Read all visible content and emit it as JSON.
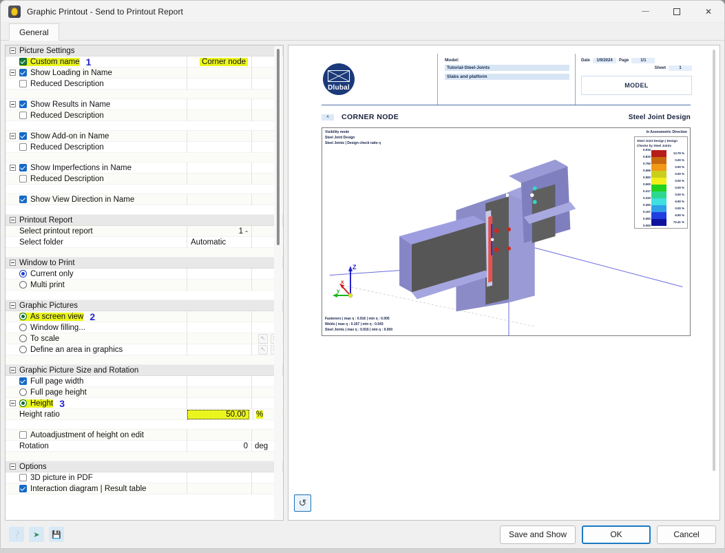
{
  "window": {
    "title": "Graphic Printout - Send to Printout Report",
    "app_icon": "dlubal-lock-icon",
    "minimize": "minimize-icon",
    "maximize": "maximize-icon",
    "close": "close-icon"
  },
  "tabs": [
    {
      "label": "General"
    }
  ],
  "tree": {
    "groups": [
      {
        "title": "Picture Settings",
        "rows": [
          {
            "label": "Custom name",
            "control": "checkbox-green-checked",
            "value": "Corner node",
            "unit": "",
            "highlight": true,
            "marker": "1"
          },
          {
            "label": "Show Loading in Name",
            "control": "checkbox-checked",
            "value": "",
            "unit": "",
            "expander": true
          },
          {
            "label": "Reduced Description",
            "control": "checkbox",
            "value": "",
            "unit": "",
            "indent": 2
          },
          {
            "spacer": true
          },
          {
            "label": "Show Results in Name",
            "control": "checkbox-checked",
            "value": "",
            "unit": "",
            "expander": true
          },
          {
            "label": "Reduced Description",
            "control": "checkbox",
            "value": "",
            "unit": "",
            "indent": 2
          },
          {
            "spacer": true
          },
          {
            "label": "Show Add-on in Name",
            "control": "checkbox-checked",
            "value": "",
            "unit": "",
            "expander": true
          },
          {
            "label": "Reduced Description",
            "control": "checkbox",
            "value": "",
            "unit": "",
            "indent": 2
          },
          {
            "spacer": true
          },
          {
            "label": "Show Imperfections in Name",
            "control": "checkbox-checked",
            "value": "",
            "unit": "",
            "expander": true
          },
          {
            "label": "Reduced Description",
            "control": "checkbox",
            "value": "",
            "unit": "",
            "indent": 2
          },
          {
            "spacer": true
          },
          {
            "label": "Show View Direction in Name",
            "control": "checkbox-checked",
            "value": "",
            "unit": ""
          },
          {
            "spacer": true
          }
        ]
      },
      {
        "title": "Printout Report",
        "rows": [
          {
            "label": "Select printout report",
            "control": "none",
            "value": "1 -",
            "unit": ""
          },
          {
            "label": "Select folder",
            "control": "none",
            "value": "Automatic",
            "unit": "",
            "value_align": "left"
          },
          {
            "spacer": true
          }
        ]
      },
      {
        "title": "Window to Print",
        "rows": [
          {
            "label": "Current only",
            "control": "radio-checked",
            "value": "",
            "unit": ""
          },
          {
            "label": "Multi print",
            "control": "radio",
            "value": "",
            "unit": ""
          },
          {
            "spacer": true
          }
        ]
      },
      {
        "title": "Graphic Pictures",
        "rows": [
          {
            "label": "As screen view",
            "control": "radio-green-checked",
            "value": "",
            "unit": "",
            "highlight": true,
            "marker": "2"
          },
          {
            "label": "Window filling...",
            "control": "radio",
            "value": "",
            "unit": ""
          },
          {
            "label": "To scale",
            "control": "radio",
            "value": "",
            "unit": "",
            "icons": [
              "pick-icon",
              "clear-icon"
            ]
          },
          {
            "label": "Define an area in graphics",
            "control": "radio",
            "value": "",
            "unit": "",
            "icons": [
              "pick-icon",
              "clear-icon"
            ]
          },
          {
            "spacer": true
          }
        ]
      },
      {
        "title": "Graphic Picture Size and Rotation",
        "rows": [
          {
            "label": "Full page width",
            "control": "checkbox-checked",
            "value": "",
            "unit": ""
          },
          {
            "label": "Full page height",
            "control": "radio",
            "value": "",
            "unit": ""
          },
          {
            "label": "Height",
            "control": "radio-green-checked",
            "value": "",
            "unit": "",
            "highlight": true,
            "marker": "3",
            "expander": true
          },
          {
            "label": "Height ratio",
            "control": "none",
            "value": "50.00",
            "unit": "%",
            "indent": 2,
            "value_highlight": true
          },
          {
            "spacer": true
          },
          {
            "label": "Autoadjustment of height on edit",
            "control": "checkbox",
            "value": "",
            "unit": ""
          },
          {
            "label": "Rotation",
            "control": "none",
            "value": "0",
            "unit": "deg"
          },
          {
            "spacer": true
          }
        ]
      },
      {
        "title": "Options",
        "rows": [
          {
            "label": "3D picture in PDF",
            "control": "checkbox",
            "value": "",
            "unit": ""
          },
          {
            "label": "Interaction diagram | Result table",
            "control": "checkbox-checked",
            "value": "",
            "unit": ""
          }
        ]
      }
    ]
  },
  "preview": {
    "logo_text": "Dlubal",
    "model_label": "Model:",
    "model_name": "Tutorial-Steel-Joints",
    "model_desc": "Slabs and platform",
    "date_key": "Date",
    "date_value": "1/9/2024",
    "page_key": "Page",
    "page_value": "1/1",
    "sheet_key": "Sheet",
    "sheet_value": "1",
    "model_box": "MODEL",
    "chip": "A",
    "section_title": "CORNER NODE",
    "section_title_right": "Steel Joint Design",
    "viewport": {
      "top_left_lines": [
        "Visibility mode",
        "Steel Joint Design",
        "Steel Joints | Design check ratio η"
      ],
      "top_right": "In Axonometric Direction",
      "bottom_left_lines": [
        "Fasteners | max η : 0.916 | min η : 0.005",
        "Welds | max η : 0.167 | min η : 0.043",
        "Steel Joints | max η : 0.916 | min η : 0.000"
      ],
      "axis_x": "x",
      "axis_y": "y",
      "axis_z": "Z"
    },
    "legend": {
      "title_line1": "Steel Joint Design | Design",
      "title_line2": "Checks by Steel Joints",
      "values": [
        "0.916",
        "0.833",
        "0.750",
        "0.666",
        "0.583",
        "0.500",
        "0.417",
        "0.333",
        "0.250",
        "0.167",
        "0.083",
        "0.000"
      ],
      "colors": [
        "#b71c1c",
        "#c86a10",
        "#f29a16",
        "#c9cf1a",
        "#f2ee1c",
        "#21d21f",
        "#2ed790",
        "#3ee0e0",
        "#2fa0e8",
        "#1f3fe0",
        "#10129e"
      ],
      "percents": [
        "13.79 %",
        "0.00 %",
        "0.00 %",
        "0.00 %",
        "0.00 %",
        "0.00 %",
        "0.00 %",
        "6.90 %",
        "0.00 %",
        "6.90 %",
        "72.41 %"
      ]
    },
    "refresh_icon": "refresh-icon"
  },
  "footer": {
    "icons": [
      "help-icon",
      "import-icon",
      "save-icon"
    ],
    "buttons": [
      {
        "label": "Save and Show",
        "primary": false
      },
      {
        "label": "OK",
        "primary": true
      },
      {
        "label": "Cancel",
        "primary": false
      }
    ]
  }
}
